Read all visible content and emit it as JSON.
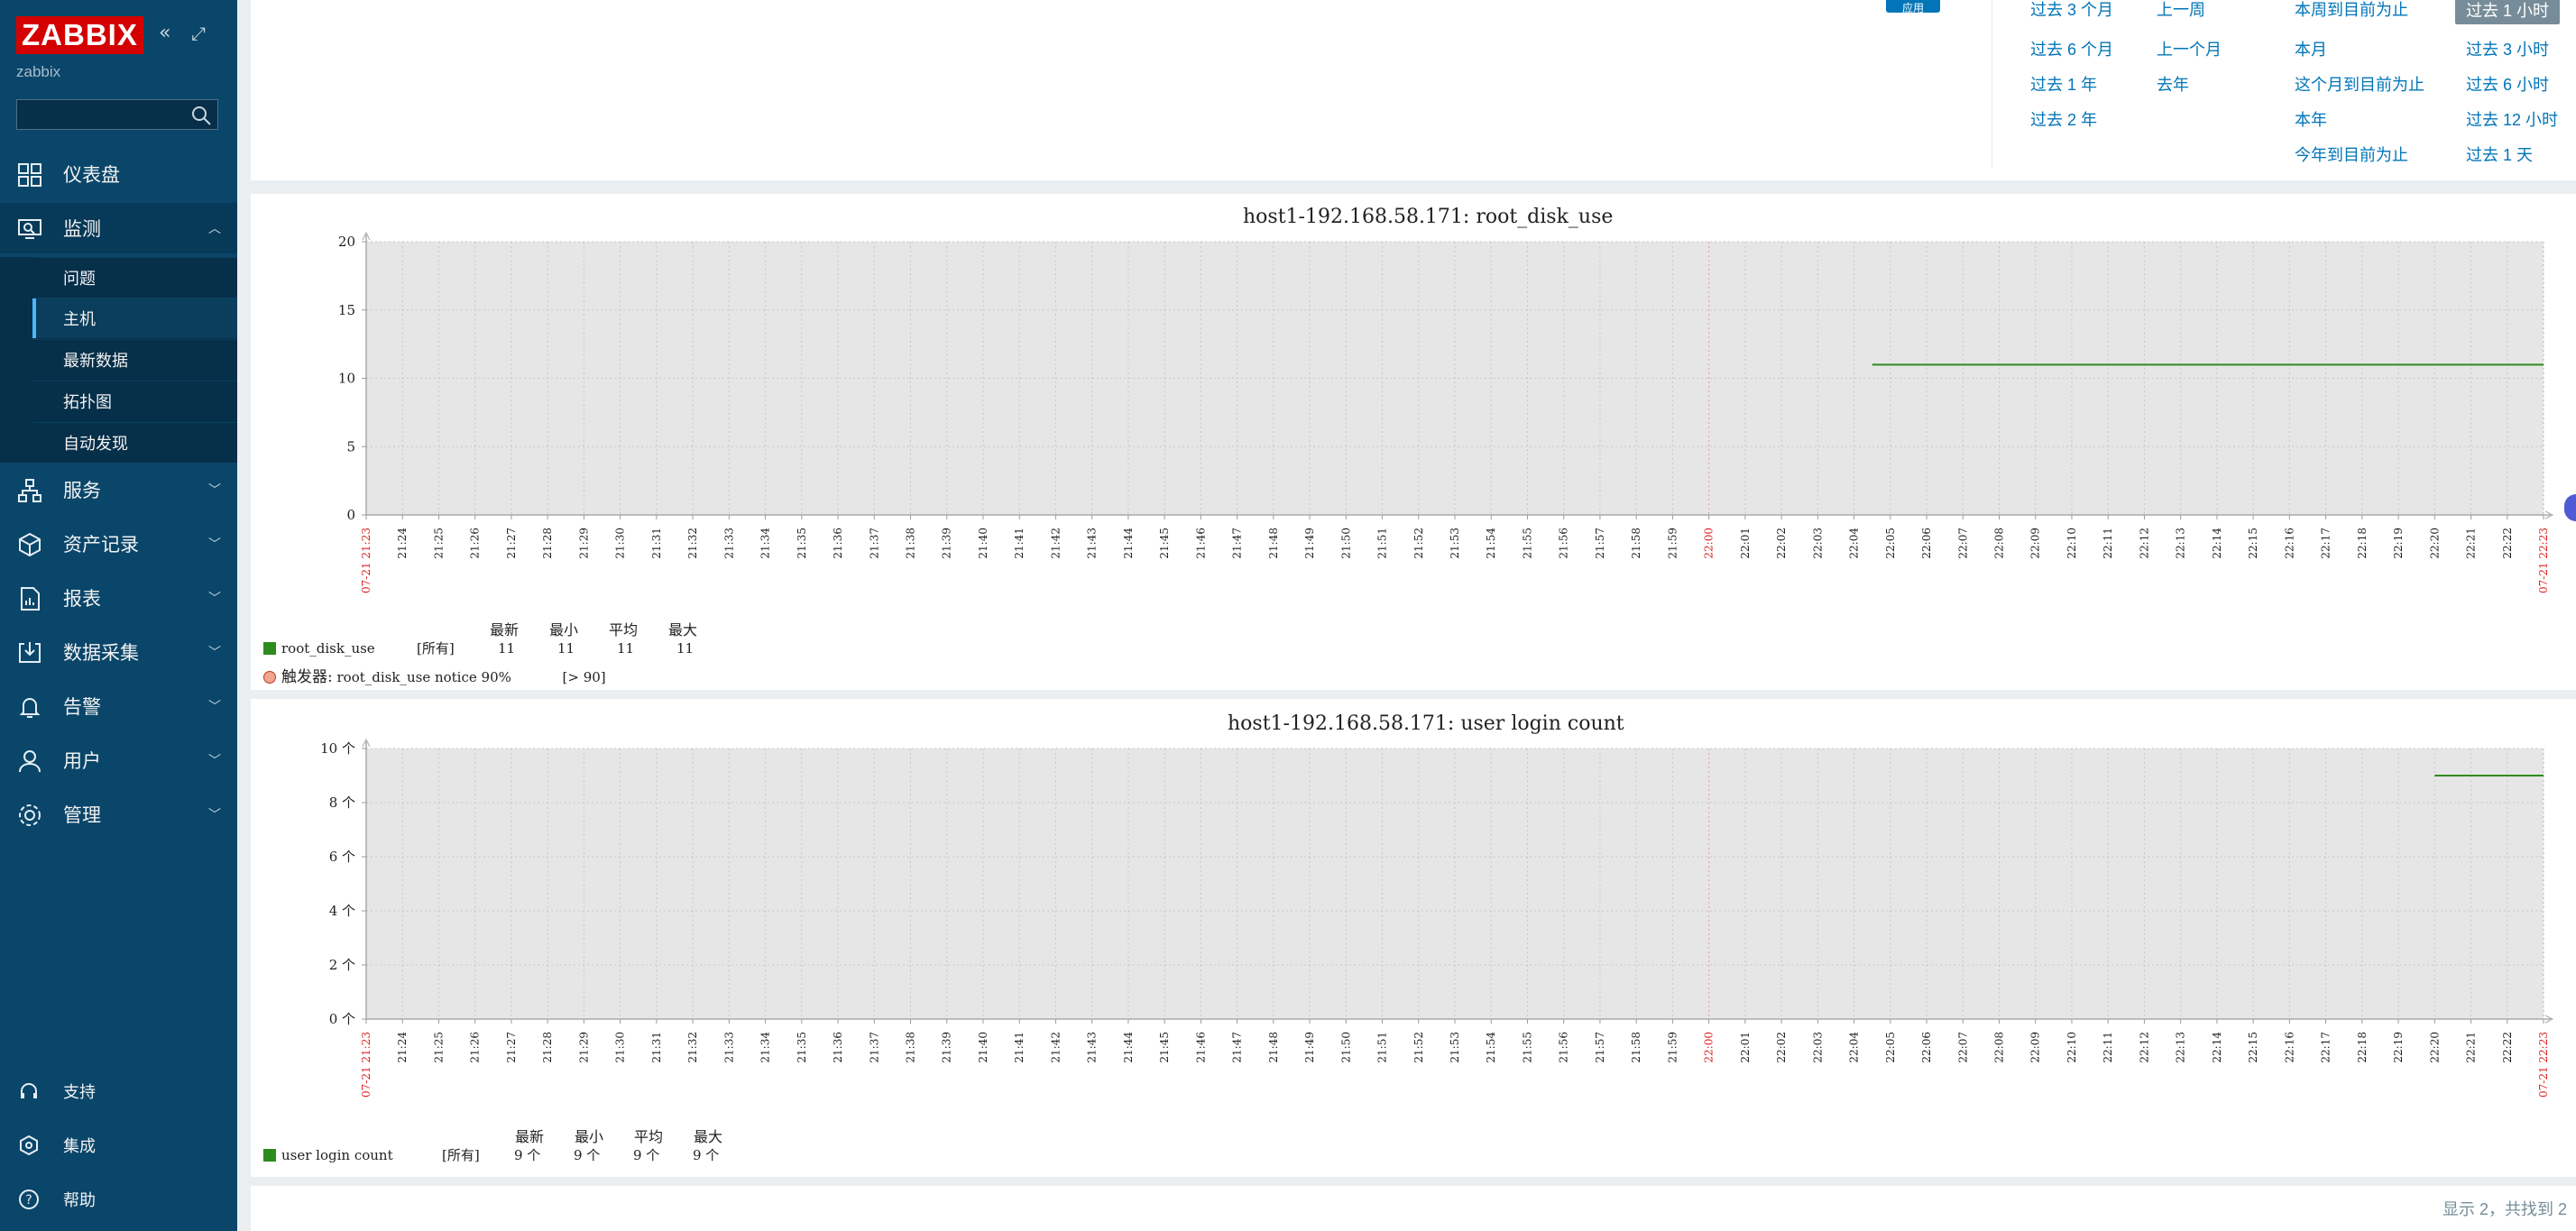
{
  "brand": {
    "logo": "ZABBIX",
    "server": "zabbix"
  },
  "search": {
    "placeholder": ""
  },
  "menu": {
    "dashboard": "仪表盘",
    "monitoring": "监测",
    "services": "服务",
    "inventory": "资产记录",
    "reports": "报表",
    "datacollection": "数据采集",
    "alerts": "告警",
    "users": "用户",
    "admin": "管理"
  },
  "submenu": {
    "problems": "问题",
    "hosts": "主机",
    "latest": "最新数据",
    "maps": "拓扑图",
    "discovery": "自动发现"
  },
  "bottom": {
    "support": "支持",
    "integrations": "集成",
    "help": "帮助"
  },
  "timeselector": {
    "apply": "应用",
    "col1": [
      "过去 3 个月",
      "过去 6 个月",
      "过去 1 年",
      "过去 2 年"
    ],
    "col2": [
      "上一周",
      "上一个月",
      "去年"
    ],
    "col3": [
      "本周到目前为止",
      "本月",
      "这个月到目前为止",
      "本年",
      "今年到目前为止"
    ],
    "col4": [
      "过去 1 小时",
      "过去 3 小时",
      "过去 6 小时",
      "过去 12 小时",
      "过去 1 天"
    ]
  },
  "graph1": {
    "title": "host1-192.168.58.171: root_disk_use",
    "legend_headers": [
      "最新",
      "最小",
      "平均",
      "最大"
    ],
    "item": {
      "name": "root_disk_use",
      "scope": "[所有]",
      "last": "11",
      "min": "11",
      "avg": "11",
      "max": "11",
      "color": "#2e8b1e"
    },
    "trigger": {
      "label": "触发器:",
      "text": "root_disk_use notice 90%",
      "cond": "[> 90]",
      "color": "#f0a58f"
    }
  },
  "graph2": {
    "title": "host1-192.168.58.171: user login count",
    "legend_headers": [
      "最新",
      "最小",
      "平均",
      "最大"
    ],
    "item": {
      "name": "user login count",
      "scope": "[所有]",
      "last": "9 个",
      "min": "9 个",
      "avg": "9 个",
      "max": "9 个",
      "color": "#2e8b1e"
    }
  },
  "chart_data": [
    {
      "type": "line",
      "title": "host1-192.168.58.171: root_disk_use",
      "ylim": [
        0,
        20
      ],
      "yticks": [
        "0",
        "5",
        "10",
        "15",
        "20"
      ],
      "xticks": [
        "07-21 21:23",
        "21:24",
        "21:25",
        "21:26",
        "21:27",
        "21:28",
        "21:29",
        "21:30",
        "21:31",
        "21:32",
        "21:33",
        "21:34",
        "21:35",
        "21:36",
        "21:37",
        "21:38",
        "21:39",
        "21:40",
        "21:41",
        "21:42",
        "21:43",
        "21:44",
        "21:45",
        "21:46",
        "21:47",
        "21:48",
        "21:49",
        "21:50",
        "21:51",
        "21:52",
        "21:53",
        "21:54",
        "21:55",
        "21:56",
        "21:57",
        "21:58",
        "21:59",
        "22:00",
        "22:01",
        "22:02",
        "22:03",
        "22:04",
        "22:05",
        "22:06",
        "22:07",
        "22:08",
        "22:09",
        "22:10",
        "22:11",
        "22:12",
        "22:13",
        "22:14",
        "22:15",
        "22:16",
        "22:17",
        "22:18",
        "22:19",
        "22:20",
        "22:21",
        "22:22",
        "07-21 22:23"
      ],
      "red_ticks": [
        "07-21 21:23",
        "22:00",
        "07-21 22:23"
      ],
      "series": [
        {
          "name": "root_disk_use",
          "color": "#2e8b1e",
          "x": [
            "22:04:30",
            "22:23"
          ],
          "values": [
            11,
            11
          ]
        }
      ]
    },
    {
      "type": "line",
      "title": "host1-192.168.58.171: user login count",
      "ylim": [
        0,
        10
      ],
      "yticks": [
        "0 个",
        "2 个",
        "4 个",
        "6 个",
        "8 个",
        "10 个"
      ],
      "xticks": [
        "07-21 21:23",
        "21:24",
        "21:25",
        "21:26",
        "21:27",
        "21:28",
        "21:29",
        "21:30",
        "21:31",
        "21:32",
        "21:33",
        "21:34",
        "21:35",
        "21:36",
        "21:37",
        "21:38",
        "21:39",
        "21:40",
        "21:41",
        "21:42",
        "21:43",
        "21:44",
        "21:45",
        "21:46",
        "21:47",
        "21:48",
        "21:49",
        "21:50",
        "21:51",
        "21:52",
        "21:53",
        "21:54",
        "21:55",
        "21:56",
        "21:57",
        "21:58",
        "21:59",
        "22:00",
        "22:01",
        "22:02",
        "22:03",
        "22:04",
        "22:05",
        "22:06",
        "22:07",
        "22:08",
        "22:09",
        "22:10",
        "22:11",
        "22:12",
        "22:13",
        "22:14",
        "22:15",
        "22:16",
        "22:17",
        "22:18",
        "22:19",
        "22:20",
        "22:21",
        "22:22",
        "07-21 22:23"
      ],
      "red_ticks": [
        "07-21 21:23",
        "22:00",
        "07-21 22:23"
      ],
      "series": [
        {
          "name": "user login count",
          "color": "#2e8b1e",
          "x": [
            "22:20",
            "22:23"
          ],
          "values": [
            9,
            9
          ]
        }
      ]
    }
  ],
  "footer": {
    "text": "显示 2，共找到 2"
  }
}
